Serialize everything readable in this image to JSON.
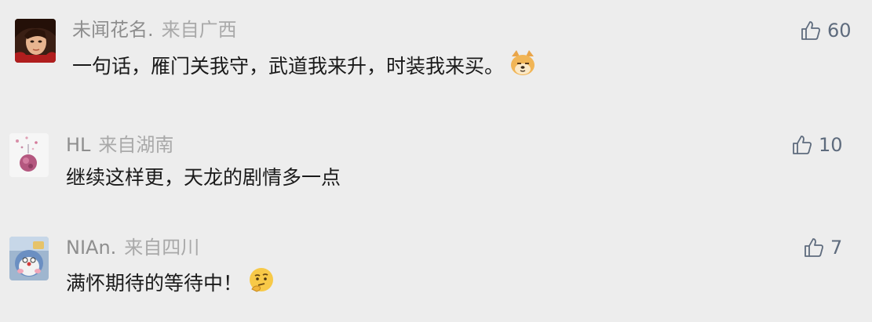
{
  "comments": [
    {
      "author": "未闻花名.",
      "location": "来自广西",
      "text": "一句话，雁门关我守，武道我来升，时装我来买。",
      "likes": "60",
      "emoji": "shiba-dog-emoji"
    },
    {
      "author": "HL",
      "location": "来自湖南",
      "text": "继续这样更，天龙的剧情多一点",
      "likes": "10"
    },
    {
      "author": "NIAn.",
      "location": "来自四川",
      "text": "满怀期待的等待中！",
      "likes": "7",
      "emoji": "thinking-face-emoji"
    }
  ],
  "colors": {
    "background": "#ededed",
    "author": "#8e8e8e",
    "text": "#1a1a1a",
    "like": "#5e6b7d"
  }
}
